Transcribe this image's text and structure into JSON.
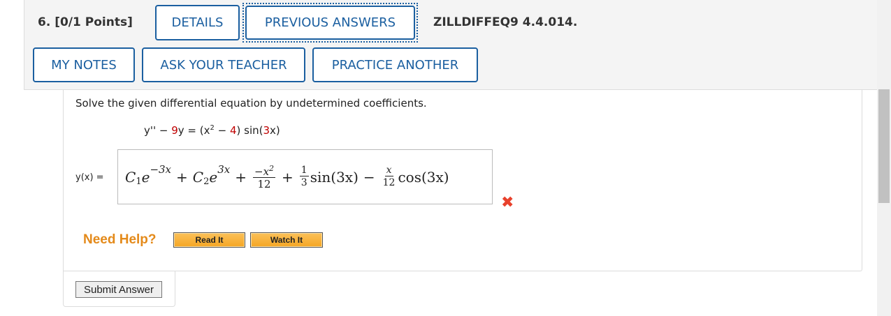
{
  "question": {
    "number_label": "6. [0/1 Points]",
    "id_label": "ZILLDIFFEQ9 4.4.014."
  },
  "toolbar": {
    "details_label": "DETAILS",
    "previous_answers_label": "PREVIOUS ANSWERS",
    "my_notes_label": "MY NOTES",
    "ask_teacher_label": "ASK YOUR TEACHER",
    "practice_another_label": "PRACTICE ANOTHER"
  },
  "problem": {
    "prompt": "Solve the given differential equation by undetermined coefficients.",
    "equation": {
      "lhs_a": "y'' − ",
      "coef": "9",
      "lhs_b": "y = (x",
      "exp": "2",
      "mid": " − ",
      "const": "4",
      "rhs": ") sin(",
      "arg_num": "3",
      "arg_end": "x)"
    }
  },
  "answer": {
    "label": "y(x) =",
    "C1": "C",
    "sub1": "1",
    "e1": "e",
    "exp1": "−3x",
    "plus1": "+",
    "C2": "C",
    "sub2": "2",
    "e2": "e",
    "exp2": "3x",
    "plus2": "+",
    "f1_num": "−x",
    "f1_num_exp": "2",
    "f1_den": "12",
    "plus3": "+",
    "f2_num": "1",
    "f2_den": "3",
    "term_sin": "sin(3x)",
    "minus": "−",
    "f3_num": "x",
    "f3_den": "12",
    "term_cos": "cos(3x)",
    "status": "incorrect",
    "status_mark": "✖"
  },
  "help": {
    "need_help_label": "Need Help?",
    "read_it_label": "Read It",
    "watch_it_label": "Watch It"
  },
  "submit": {
    "label": "Submit Answer"
  },
  "colors": {
    "accent": "#1b5fa0",
    "error": "#e8412c",
    "help": "#e48a1a",
    "highlight": "#c00000"
  }
}
